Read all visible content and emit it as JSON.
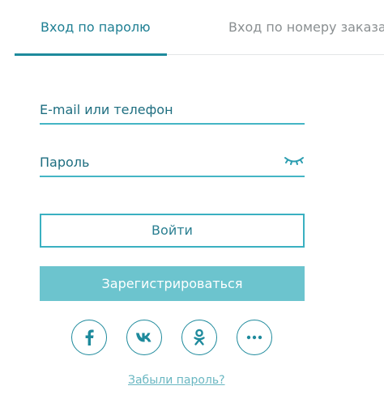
{
  "tabs": [
    {
      "label": "Вход по паролю",
      "active": true
    },
    {
      "label": "Вход по номеру заказа",
      "active": false
    }
  ],
  "form": {
    "login_placeholder": "E-mail или телефон",
    "password_placeholder": "Пароль",
    "login_value": "",
    "password_value": ""
  },
  "buttons": {
    "login": "Войти",
    "register": "Зарегистрироваться"
  },
  "social": [
    {
      "icon": "facebook-icon"
    },
    {
      "icon": "vk-icon"
    },
    {
      "icon": "odnoklassniki-icon"
    },
    {
      "icon": "more-icon"
    }
  ],
  "links": {
    "forgot_password": "Забыли пароль?"
  },
  "colors": {
    "accent": "#1e8a9c",
    "register_bg": "#6cc4ce",
    "inactive_tab": "#8a8f91"
  }
}
